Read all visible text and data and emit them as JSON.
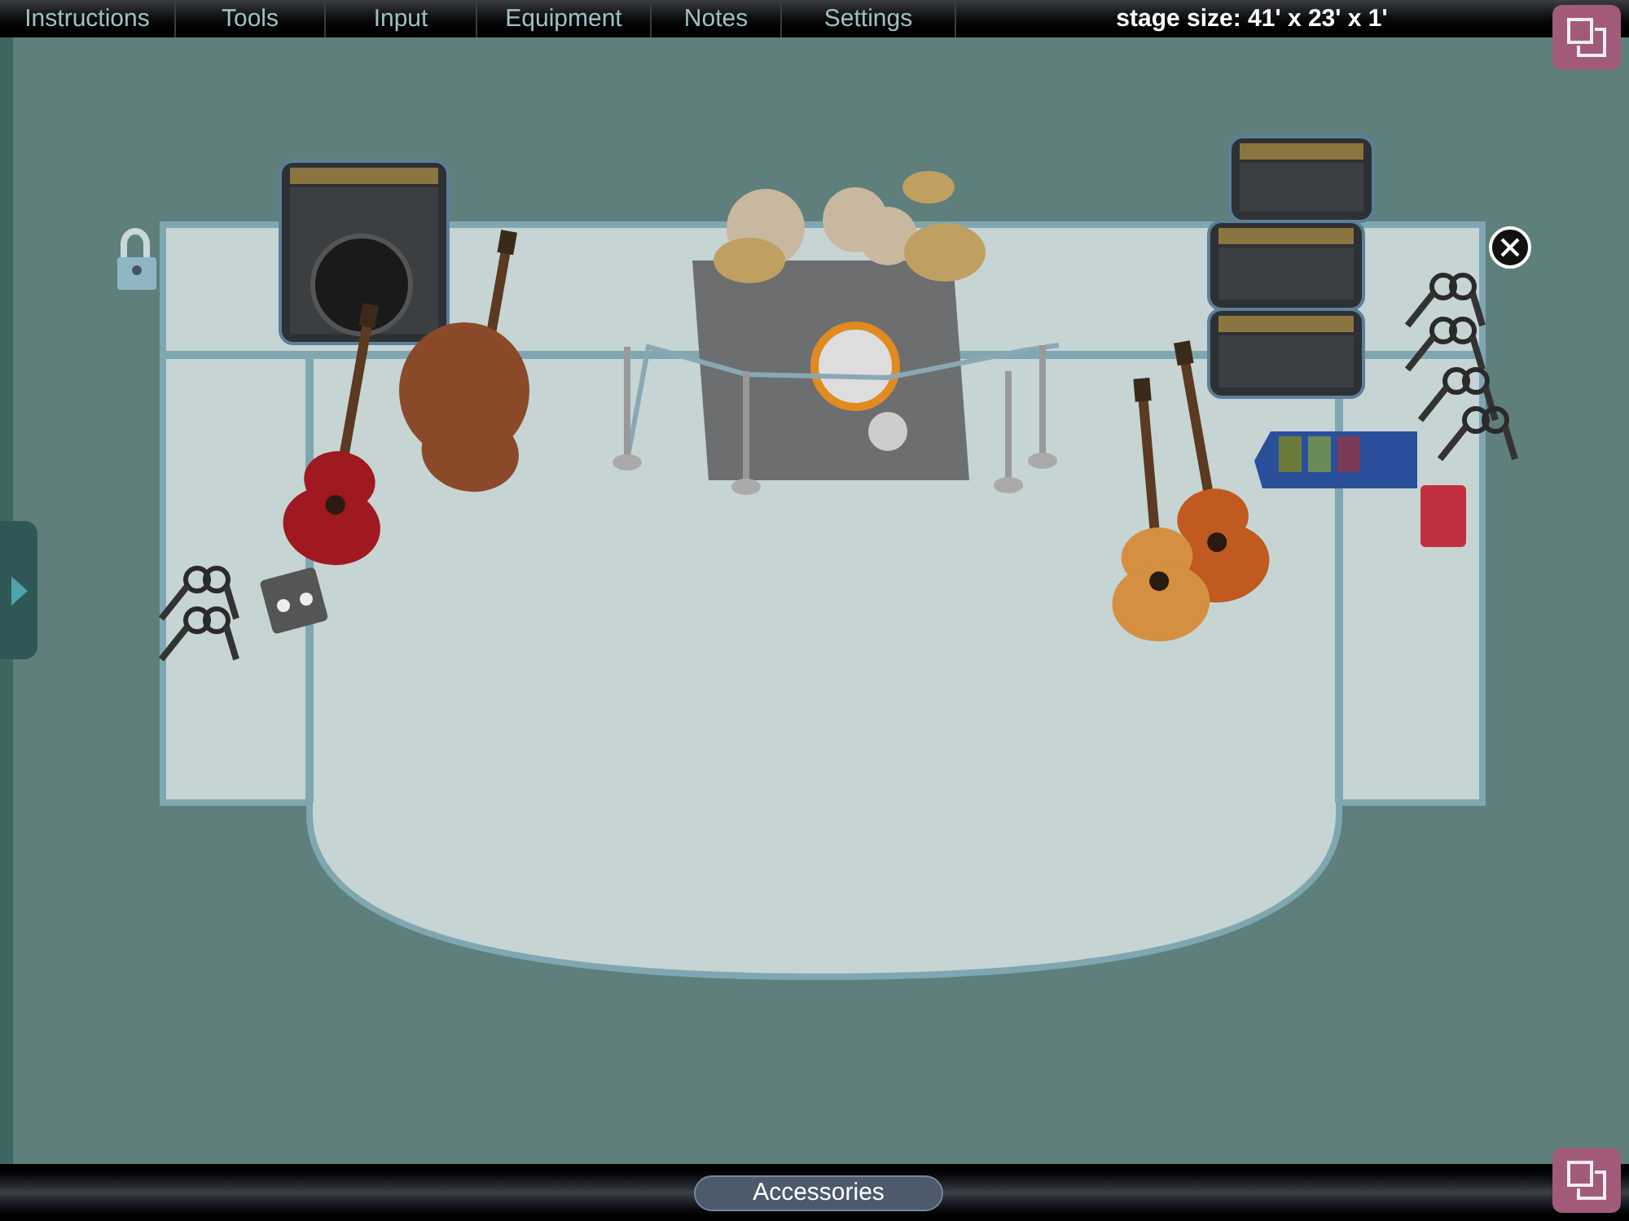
{
  "menu": [
    {
      "label": "Instructions"
    },
    {
      "label": "Tools"
    },
    {
      "label": "Input"
    },
    {
      "label": "Equipment"
    },
    {
      "label": "Notes"
    },
    {
      "label": "Settings"
    }
  ],
  "stage_size": "stage size: 41' x 23' x 1'",
  "bottom_bar": {
    "button": "Accessories"
  }
}
